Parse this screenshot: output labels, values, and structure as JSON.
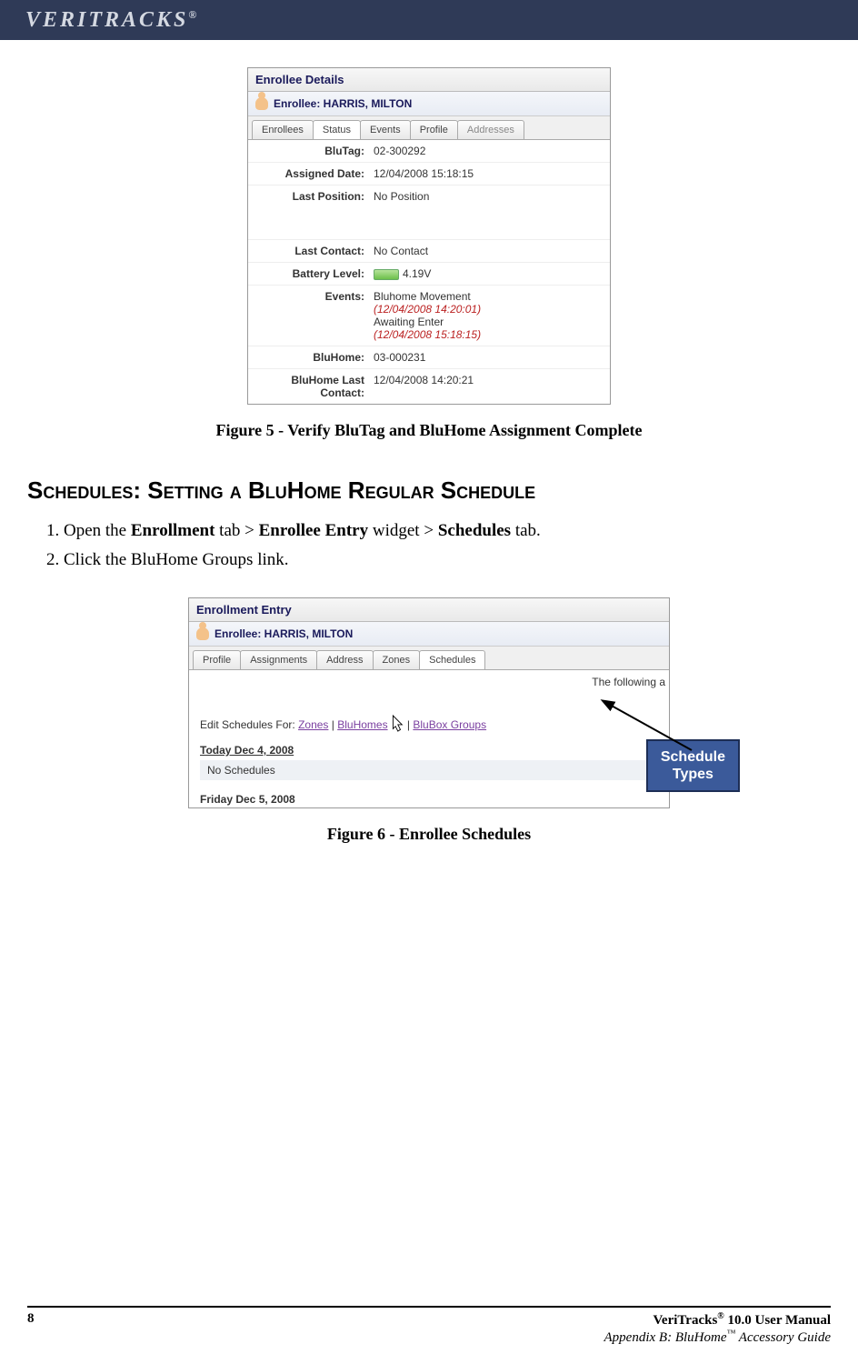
{
  "brand": {
    "name": "VERITRACKS",
    "reg": "®"
  },
  "figure5": {
    "panelTitle": "Enrollee Details",
    "enrolleeLabel": "Enrollee: HARRIS, MILTON",
    "tabs": [
      "Enrollees",
      "Status",
      "Events",
      "Profile",
      "Addresses"
    ],
    "activeTab": "Status",
    "rows": {
      "blutag": {
        "label": "BluTag:",
        "value": "02-300292"
      },
      "assigned": {
        "label": "Assigned Date:",
        "value": "12/04/2008 15:18:15"
      },
      "lastpos": {
        "label": "Last Position:",
        "value": "No Position"
      },
      "lastcontact": {
        "label": "Last Contact:",
        "value": "No Contact"
      },
      "battery": {
        "label": "Battery Level:",
        "value": "4.19V"
      },
      "events": {
        "label": "Events:",
        "e1": "Bluhome Movement",
        "t1": "(12/04/2008 14:20:01)",
        "e2": "Awaiting Enter",
        "t2": "(12/04/2008 15:18:15)"
      },
      "bluhome": {
        "label": "BluHome:",
        "value": "03-000231"
      },
      "bhlast": {
        "label": "BluHome Last Contact:",
        "value": "12/04/2008 14:20:21"
      }
    },
    "caption": "Figure 5 - Verify BluTag and BluHome Assignment Complete"
  },
  "section": {
    "heading": "Schedules: Setting a BluHome Regular Schedule",
    "step1_pre": "Open the ",
    "step1_b1": "Enrollment",
    "step1_mid1": " tab > ",
    "step1_b2": "Enrollee Entry",
    "step1_mid2": " widget > ",
    "step1_b3": "Schedules",
    "step1_post": " tab.",
    "step2": "Click the BluHome Groups link."
  },
  "figure6": {
    "panelTitle": "Enrollment Entry",
    "enrolleeLabel": "Enrollee: HARRIS, MILTON",
    "tabs": [
      "Profile",
      "Assignments",
      "Address",
      "Zones",
      "Schedules"
    ],
    "activeTab": "Schedules",
    "cutText": "The following a",
    "editPrefix": "Edit Schedules For: ",
    "links": {
      "zones": "Zones",
      "bluhomes": "BluHomes",
      "blubox": "BluBox Groups"
    },
    "sep": " | ",
    "today": "Today Dec 4, 2008",
    "nosched": "No Schedules",
    "friday": "Friday Dec 5, 2008",
    "calloutLine1": "Schedule",
    "calloutLine2": "Types",
    "caption": "Figure 6 - Enrollee Schedules"
  },
  "footer": {
    "page": "8",
    "line1a": "VeriTracks",
    "line1sup": "®",
    "line1b": " 10.0 User Manual",
    "line2a": "Appendix B: BluHome",
    "line2sup": "™",
    "line2b": " Accessory Guide"
  }
}
